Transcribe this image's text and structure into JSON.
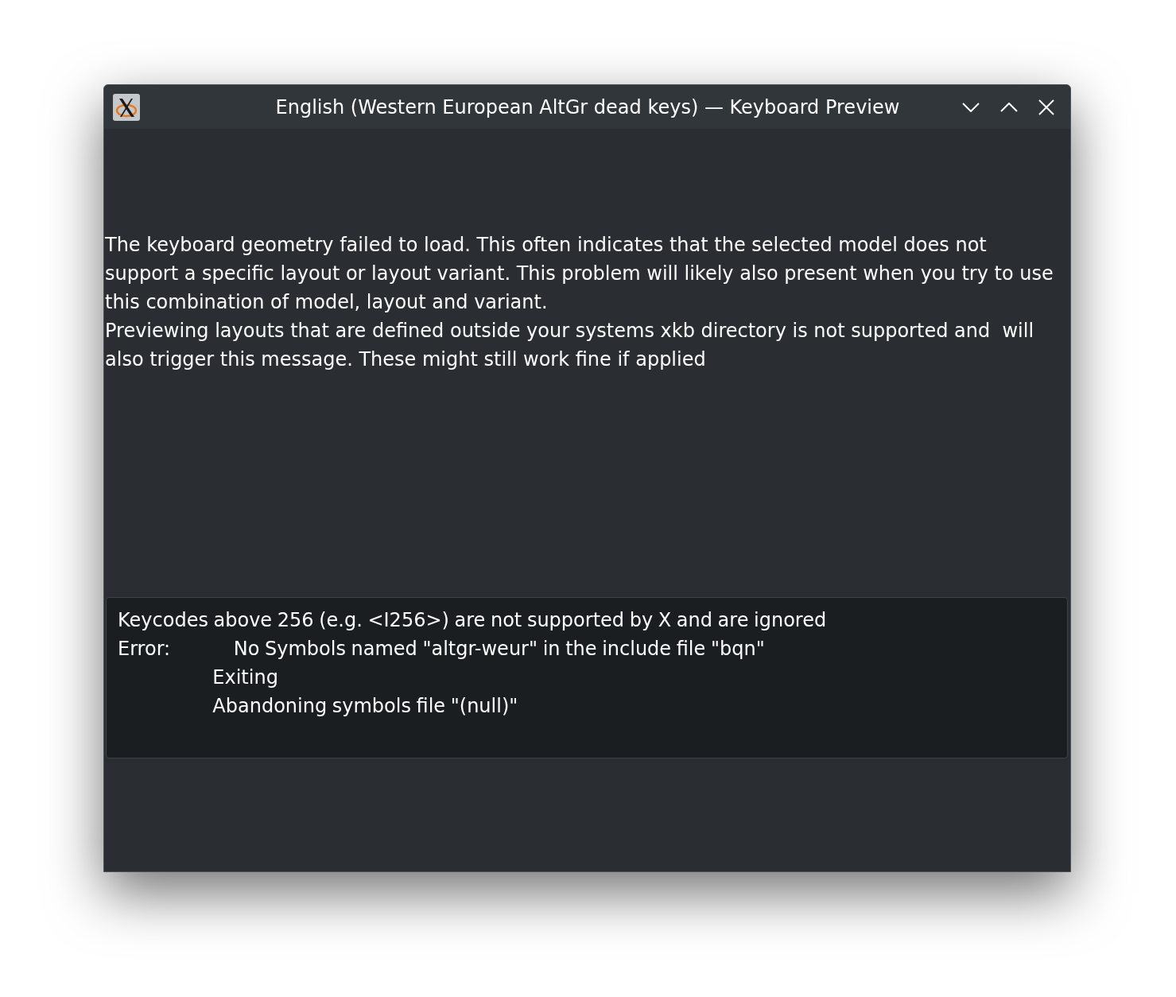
{
  "window": {
    "title": "English (Western European AltGr dead keys) — Keyboard Preview",
    "controls": [
      {
        "kind": "minimize"
      },
      {
        "kind": "maximize"
      },
      {
        "kind": "close"
      }
    ]
  },
  "message": {
    "paragraphs": [
      "The keyboard geometry failed to load. This often indicates that the selected model does not support a specific layout or layout variant. This problem will likely also present when you try to use this combination of model, layout and variant.",
      "Previewing layouts that are defined outside your systems xkb directory is not supported and  will also trigger this message. These might still work fine if applied"
    ]
  },
  "log": {
    "text": "Keycodes above 256 (e.g. <I256>) are not supported by X and are ignored\nError:            No Symbols named \"altgr-weur\" in the include file \"bqn\"\n                  Exiting\n                  Abandoning symbols file \"(null)\""
  }
}
